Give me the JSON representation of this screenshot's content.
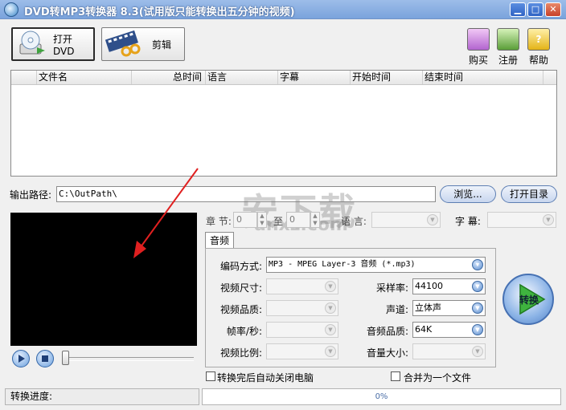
{
  "window": {
    "title": "DVD转MP3转换器 8.3(试用版只能转换出五分钟的视频)",
    "controls": {
      "minimize": "▁",
      "maximize": "□",
      "close": "✕"
    }
  },
  "toolbar": {
    "open_dvd": "打开DVD",
    "edit": "剪辑",
    "buy": "购买",
    "register": "注册",
    "help": "帮助"
  },
  "table": {
    "columns": [
      "文件名",
      "总时间",
      "语言",
      "字幕",
      "开始时间",
      "结束时间"
    ]
  },
  "output": {
    "label": "输出路径:",
    "path": "C:\\OutPath\\",
    "browse": "浏览...",
    "open_dir": "打开目录"
  },
  "chapter": {
    "label": "章  节:",
    "from": "0",
    "to_label": "至",
    "to": "0",
    "language_label": "语  言:",
    "subtitle_label": "字  幕:"
  },
  "audio_tab": "音频",
  "settings": {
    "encoding_label": "编码方式:",
    "encoding_value": "MP3 - MPEG Layer-3 音频 (*.mp3)",
    "video_size_label": "视频尺寸:",
    "video_quality_label": "视频品质:",
    "framerate_label": "帧率/秒:",
    "aspect_label": "视频比例:",
    "samplerate_label": "采样率:",
    "samplerate_value": "44100",
    "channel_label": "声道:",
    "channel_value": "立体声",
    "audio_quality_label": "音频品质:",
    "audio_quality_value": "64K",
    "volume_label": "音量大小:"
  },
  "convert_button": "转换",
  "options": {
    "shutdown": "转换完后自动关闭电脑",
    "merge": "合并为一个文件"
  },
  "status": {
    "label": "转换进度:",
    "progress": "0%",
    "progress_fraction": 0
  },
  "watermark": {
    "main": "安下载",
    "sub": "anxz.com"
  },
  "colors": {
    "titlebar": "#7aa3dc",
    "annotation_arrow": "#e02020"
  }
}
